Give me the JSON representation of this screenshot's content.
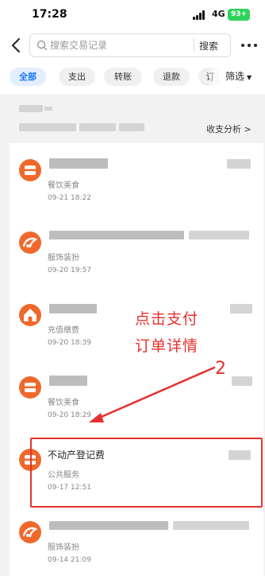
{
  "status_bar": {
    "time": "17:28",
    "network": "4G",
    "battery": "93+"
  },
  "nav": {
    "search_placeholder": "搜索交易记录",
    "search_button": "搜索"
  },
  "filters": {
    "chips": [
      "全部",
      "支出",
      "转账",
      "退款",
      "订"
    ],
    "active_index": 0,
    "filter_label": "筛选"
  },
  "summary": {
    "analysis_link": "收支分析 >"
  },
  "records": [
    {
      "name": "",
      "category": "餐饮美食",
      "time": "09-21 18:22",
      "icon": "food-icon"
    },
    {
      "name": "",
      "category": "服饰装扮",
      "time": "09-20 19:57",
      "icon": "taobao-icon"
    },
    {
      "name": "",
      "category": "充值缴费",
      "time": "09-20 18:39",
      "icon": "home-icon"
    },
    {
      "name": "",
      "category": "餐饮美食",
      "time": "09-20 18:29",
      "icon": "food-icon"
    },
    {
      "name": "不动产登记费",
      "category": "公共服务",
      "time": "09-17 12:51",
      "icon": "food-icon"
    },
    {
      "name": "",
      "category": "服饰装扮",
      "time": "09-14 21:09",
      "icon": "taobao-icon"
    }
  ],
  "annotation": {
    "line1": "点击支付",
    "line2": "订单详情",
    "step": "2"
  },
  "colors": {
    "accent": "#1677ff",
    "record_icon": "#f0682b",
    "annotation": "#e83030",
    "battery": "#2fd35b"
  }
}
